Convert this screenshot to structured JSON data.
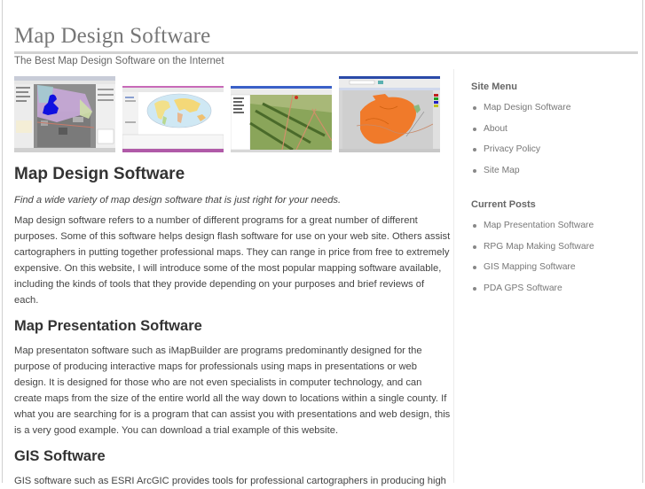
{
  "header": {
    "site_title": "Map Design Software",
    "tagline": "The Best Map Design Software on the Internet"
  },
  "thumbnails": [
    {
      "name": "map-screenshot-1",
      "description": "GIS application with aerial map and blue parcel overlay"
    },
    {
      "name": "map-screenshot-2",
      "description": "Application showing world map"
    },
    {
      "name": "map-screenshot-3",
      "description": "Application showing green aerial farmland map"
    },
    {
      "name": "map-screenshot-4",
      "description": "Application showing orange parcel map"
    }
  ],
  "main": {
    "post_title": "Map Design Software",
    "intro": "Find a wide variety of map design software that is just right for your needs.",
    "intro_paragraph": "Map design software refers to a number of different programs for a great number of different purposes. Some of this software helps design flash software for use on your web site. Others assist cartographers in putting together professional maps. They can range in price from free to extremely expensive. On this website, I will introduce some of the most popular mapping software available, including the kinds of tools that they provide depending on your purposes and brief reviews of each.",
    "sections": [
      {
        "title": "Map Presentation Software",
        "body": "Map presentaton software such as iMapBuilder are programs predominantly designed for the purpose of producing interactive maps for professionals using maps in presentations or web design. It is designed for those who are not even specialists in computer technology, and can create maps from the size of the entire world all the way down to locations within a single county. If what you are searching for is a program that can assist you with presentations and web design, this is a very good example. You can download a trial example of this website."
      },
      {
        "title": "GIS Software",
        "body": "GIS software such as ESRI ArcGIC provides tools for professional cartographers in producing high"
      }
    ]
  },
  "sidebar": {
    "site_menu": {
      "heading": "Site Menu",
      "items": [
        "Map Design Software",
        "About",
        "Privacy Policy",
        "Site Map"
      ]
    },
    "current_posts": {
      "heading": "Current Posts",
      "items": [
        "Map Presentation Software",
        "RPG Map Making Software",
        "GIS Mapping Software",
        "PDA GPS Software"
      ]
    }
  }
}
